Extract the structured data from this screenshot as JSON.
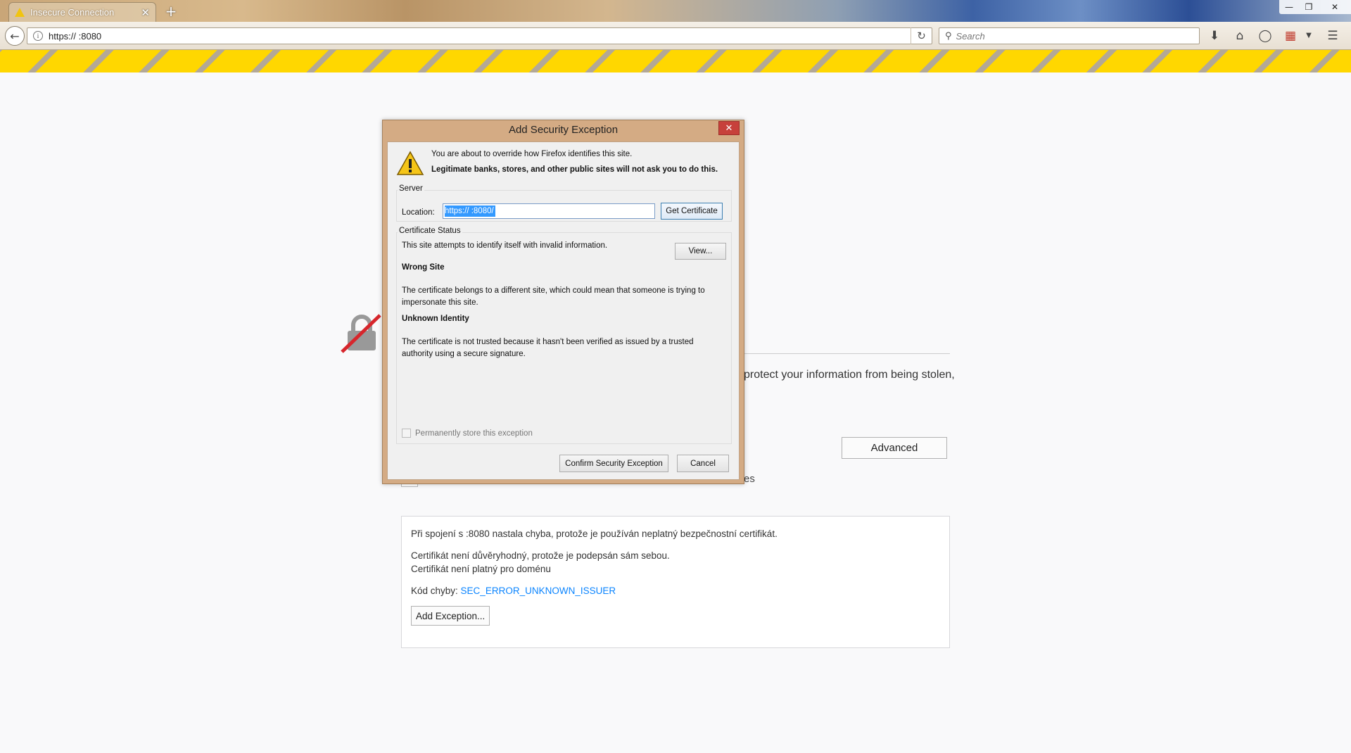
{
  "browser": {
    "tab_title": "Insecure Connection",
    "tab_close": "✕",
    "new_tab": "+",
    "url": "https://                   :8080",
    "search_placeholder": "Search",
    "window_minimize": "—",
    "window_restore": "❐",
    "window_close": "✕"
  },
  "error_page": {
    "partial_text": "protect your information from being stolen,",
    "advanced_label": "Advanced",
    "checkbox_tail": "es",
    "details": {
      "line1": "Při spojení s                        :8080 nastala chyba, protože je používán neplatný bezpečnostní certifikát.",
      "line2": "Certifikát není důvěryhodný, protože je podepsán sám sebou.",
      "line3": "Certifikát není platný pro doménu",
      "error_code_label": "Kód chyby: ",
      "error_code": "SEC_ERROR_UNKNOWN_ISSUER",
      "add_exception_label": "Add Exception..."
    }
  },
  "dialog": {
    "title": "Add Security Exception",
    "close": "✕",
    "intro_line1": "You are about to override how Firefox identifies this site.",
    "intro_line2": "Legitimate banks, stores, and other public sites will not ask you to do this.",
    "server_group": "Server",
    "location_label": "Location:",
    "location_value": "https://                   :8080/",
    "get_certificate": "Get Certificate",
    "status_group": "Certificate Status",
    "status_line": "This site attempts to identify itself with invalid information.",
    "view_button": "View...",
    "wrong_site_title": "Wrong Site",
    "wrong_site_desc": "The certificate belongs to a different site, which could mean that someone is trying to impersonate this site.",
    "unknown_identity_title": "Unknown Identity",
    "unknown_identity_desc": "The certificate is not trusted because it hasn't been verified as issued by a trusted authority using a secure signature.",
    "permanent_label": "Permanently store this exception",
    "confirm_button": "Confirm Security Exception",
    "cancel_button": "Cancel"
  },
  "colors": {
    "warning_stripe": "#ffd700",
    "dialog_frame": "#d4ab84",
    "close_red": "#c7413b",
    "link_blue": "#0a84ff"
  }
}
